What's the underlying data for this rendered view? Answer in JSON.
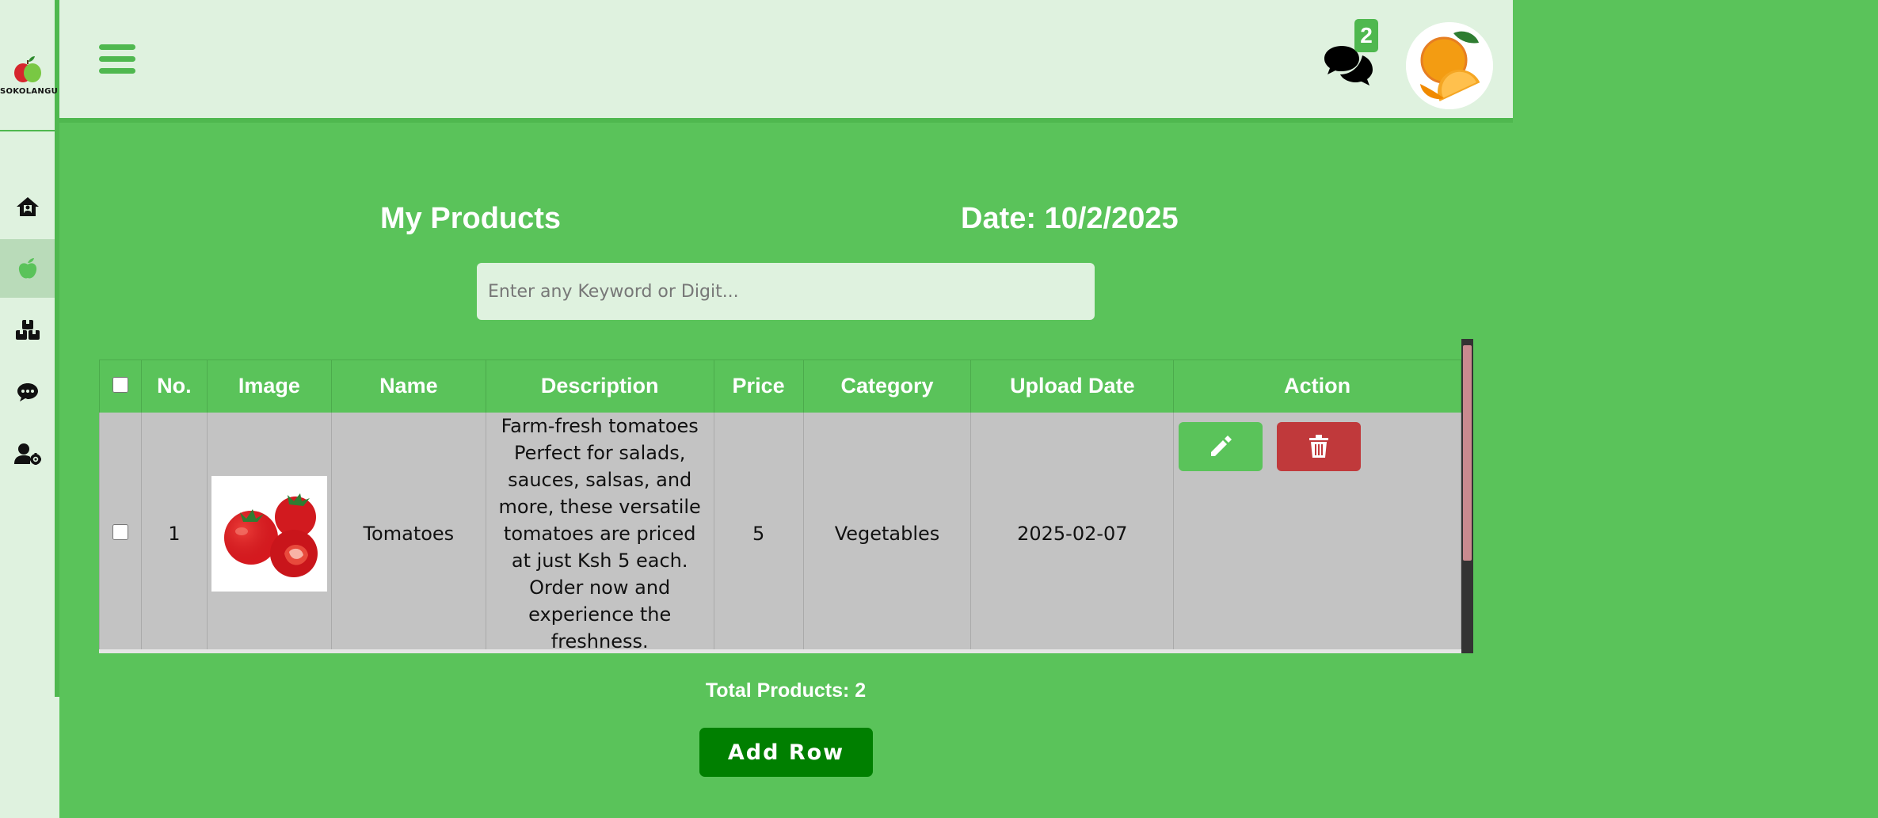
{
  "app": {
    "logo_text": "SOKOLANGU",
    "brand_color": "#5ac35a",
    "light_color": "#dff2df"
  },
  "sidebar": {
    "items": [
      {
        "icon": "home-icon",
        "active": false
      },
      {
        "icon": "apple-icon",
        "active": true
      },
      {
        "icon": "boxes-icon",
        "active": false
      },
      {
        "icon": "chat-icon",
        "active": false
      },
      {
        "icon": "user-settings-icon",
        "active": false
      }
    ]
  },
  "header": {
    "menu_icon": "hamburger-icon",
    "messages_icon": "comments-icon",
    "messages_badge": "2",
    "avatar_icon": "orange-avatar"
  },
  "main": {
    "title": "My Products",
    "date": "Date: 10/2/2025",
    "search": {
      "placeholder": "Enter any Keyword or Digit..."
    },
    "table": {
      "columns": [
        "No.",
        "Image",
        "Name",
        "Description",
        "Price",
        "Category",
        "Upload Date",
        "Action"
      ],
      "rows": [
        {
          "no": "1",
          "image": "tomatoes-image",
          "name": "Tomatoes",
          "description": "Farm-fresh tomatoes Perfect for salads, sauces, salsas, and more, these versatile tomatoes are priced at just Ksh 5 each. Order now and experience the freshness.",
          "price": "5",
          "category": "Vegetables",
          "upload_date": "2025-02-07"
        }
      ]
    },
    "total_products": "Total Products: 2",
    "add_row_label": "Add Row"
  }
}
